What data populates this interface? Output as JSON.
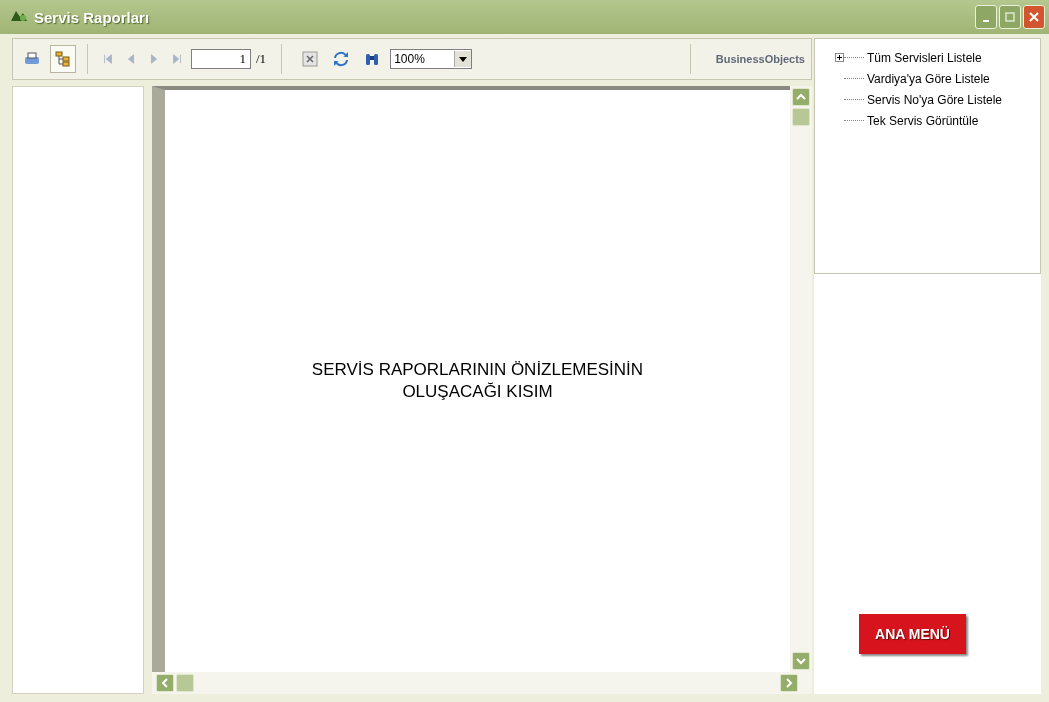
{
  "window": {
    "title": "Servis Raporları"
  },
  "toolbar": {
    "group_tree_button": {
      "selected": true
    },
    "nav_buttons": [
      {
        "kind": "first",
        "disabled": true
      },
      {
        "kind": "prev",
        "disabled": true
      },
      {
        "kind": "next",
        "disabled": true
      },
      {
        "kind": "last",
        "disabled": true
      }
    ],
    "page_field": {
      "value": "1"
    },
    "page_total": "/1",
    "zoom": {
      "value": "100%"
    },
    "logo": "Business**Objects**"
  },
  "preview": {
    "text": "SERVİS RAPORLARININ ÖNİZLEMESİNİN OLUŞACAĞI KISIM"
  },
  "report_tree": [
    {
      "label": "Tüm Servisleri Listele",
      "expanded": false
    },
    {
      "label": "Vardiya'ya Göre Listele"
    },
    {
      "label": "Servis No'ya Göre Listele"
    },
    {
      "label": "Tek Servis Görüntüle"
    }
  ],
  "main_menu_button": "ANA MENÜ"
}
